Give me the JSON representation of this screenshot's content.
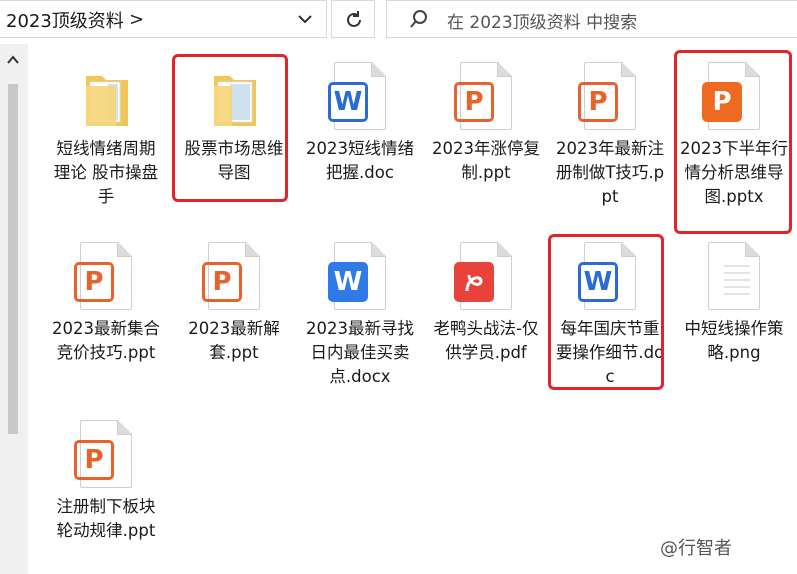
{
  "address": {
    "path": "2023顶级资料",
    "chevron": ">"
  },
  "search": {
    "placeholder": "在 2023顶级资料 中搜索"
  },
  "files": [
    {
      "name": "短线情绪周期理论 股市操盘手",
      "type": "folder"
    },
    {
      "name": "股票市场思维导图",
      "type": "folder"
    },
    {
      "name": "2023短线情绪把握.doc",
      "type": "word"
    },
    {
      "name": "2023年涨停复制.ppt",
      "type": "ppt"
    },
    {
      "name": "2023年最新注册制做T技巧.ppt",
      "type": "ppt"
    },
    {
      "name": "2023下半年行情分析思维导图.pptx",
      "type": "pptx"
    },
    {
      "name": "2023最新集合竞价技巧.ppt",
      "type": "ppt"
    },
    {
      "name": "2023最新解套.ppt",
      "type": "ppt"
    },
    {
      "name": "2023最新寻找日内最佳买卖点.docx",
      "type": "docx"
    },
    {
      "name": "老鸭头战法-仅供学员.pdf",
      "type": "pdf"
    },
    {
      "name": "每年国庆节重要操作细节.doc",
      "type": "word"
    },
    {
      "name": "中短线操作策略.png",
      "type": "png"
    },
    {
      "name": "注册制下板块轮动规律.ppt",
      "type": "ppt"
    }
  ],
  "icons": {
    "ppt_letter": "P",
    "word_letter": "W"
  },
  "watermark": "@行智者",
  "colors": {
    "highlight": "#e0252a",
    "ppt": "#e8632b",
    "word": "#2b6cd4",
    "pdf": "#e8423b"
  }
}
